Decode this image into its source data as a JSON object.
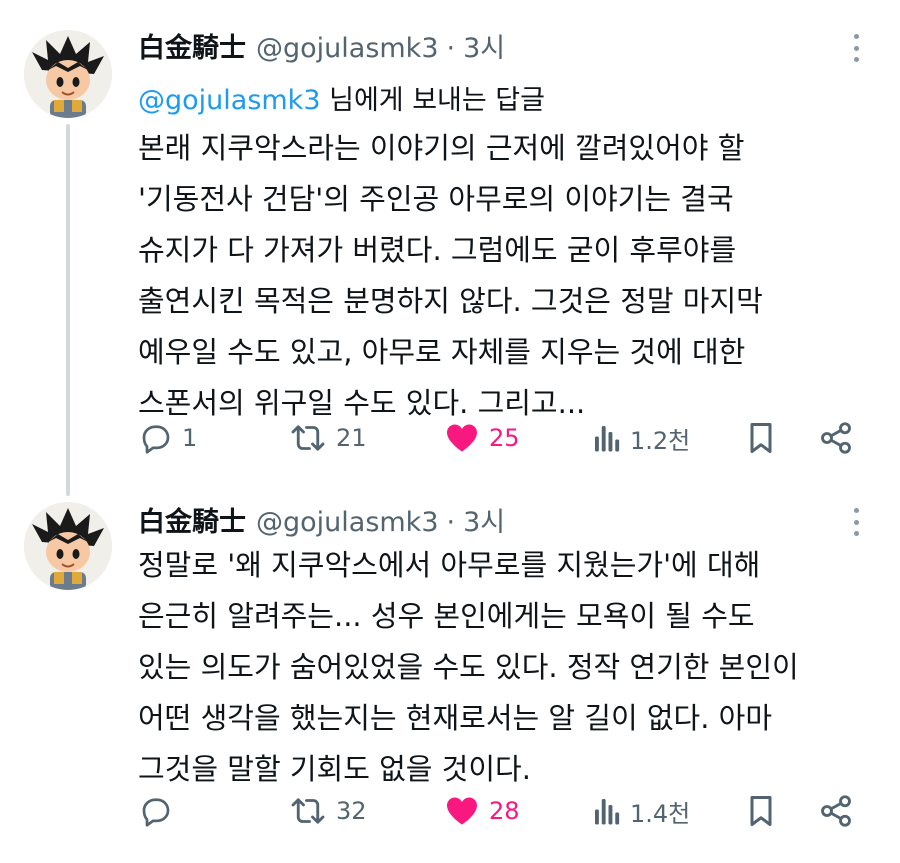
{
  "tweets": [
    {
      "author_name": "白金騎士",
      "handle": "@gojulasmk3",
      "separator": "·",
      "time": "3시",
      "reply_mention": "@gojulasmk3",
      "reply_suffix": " 님에게 보내는 답글",
      "lines": [
        "본래 지쿠악스라는 이야기의 근저에 깔려있어야 할",
        "'기동전사 건담'의 주인공 아무로의 이야기는 결국",
        "슈지가 다 가져가 버렸다. 그럼에도 굳이 후루야를",
        "출연시킨 목적은 분명하지 않다. 그것은 정말 마지막",
        "예우일 수도 있고, 아무로 자체를 지우는 것에 대한",
        "스폰서의 위구일 수도 있다. 그리고..."
      ],
      "stats": {
        "replies": "1",
        "retweets": "21",
        "likes": "25",
        "views": "1.2천"
      },
      "icons": [
        "reply-icon",
        "retweet-icon",
        "heart-icon",
        "views-icon",
        "bookmark-icon",
        "share-icon"
      ]
    },
    {
      "author_name": "白金騎士",
      "handle": "@gojulasmk3",
      "separator": "·",
      "time": "3시",
      "lines": [
        "정말로 '왜 지쿠악스에서 아무로를 지웠는가'에 대해",
        "은근히 알려주는... 성우 본인에게는 모욕이 될 수도",
        "있는 의도가 숨어있었을 수도 있다. 정작 연기한 본인이",
        "어떤 생각을 했는지는 현재로서는 알 길이 없다. 아마",
        "그것을 말할 기회도 없을 것이다."
      ],
      "stats": {
        "replies": "",
        "retweets": "32",
        "likes": "28",
        "views": "1.4천"
      },
      "icons": [
        "reply-icon",
        "retweet-icon",
        "heart-icon",
        "views-icon",
        "bookmark-icon",
        "share-icon"
      ]
    }
  ],
  "colors": {
    "accent": "#1d9bf0",
    "like": "#f91880",
    "muted": "#536471",
    "text": "#0f1419",
    "thread": "#cfd9de"
  }
}
